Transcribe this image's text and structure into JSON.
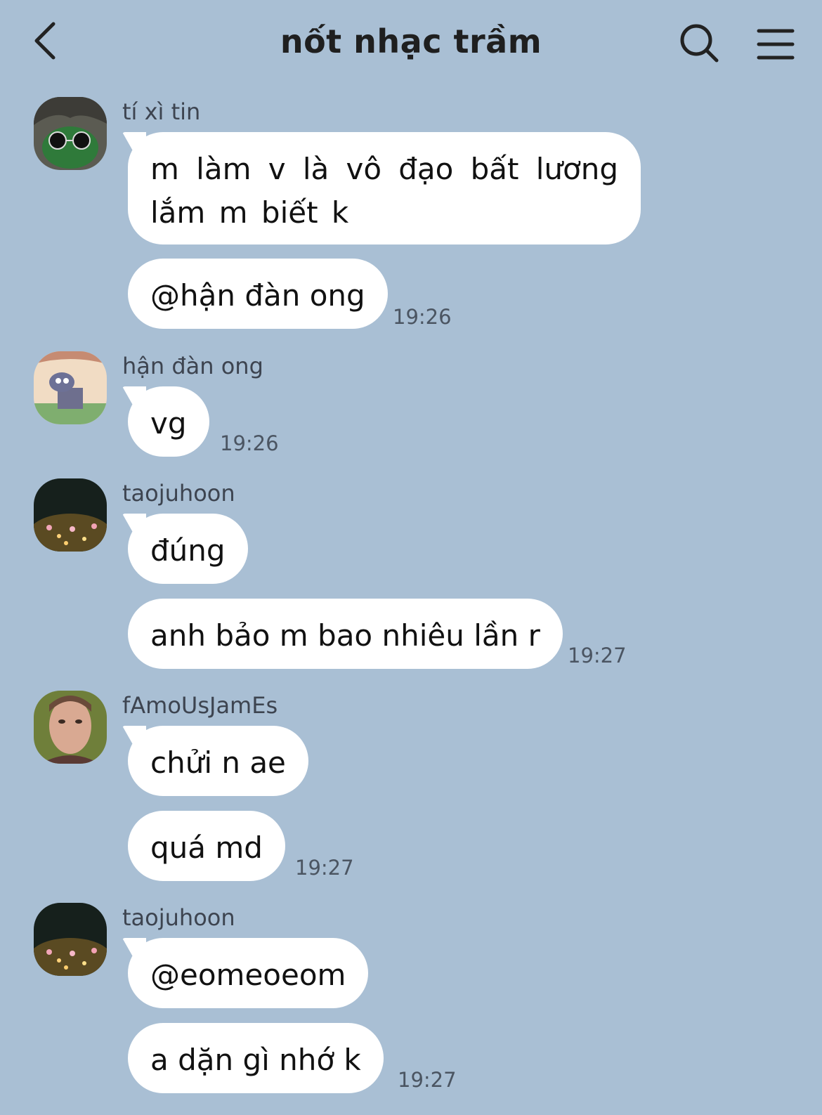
{
  "header": {
    "title": "nốt nhạc trầm",
    "back_icon": "chevron-left-icon",
    "search_icon": "search-icon",
    "menu_icon": "hamburger-menu-icon"
  },
  "colors": {
    "background": "#a9bfd4",
    "bubble": "#ffffff",
    "title": "#1f1f1f",
    "meta_text": "#4b5562"
  },
  "messages": [
    {
      "sender": "tí xì tin",
      "bubbles": [
        "m làm v là vô đạo bất lương lắm m biết k",
        "@hận đàn ong"
      ],
      "time": "19:26"
    },
    {
      "sender": "hận đàn ong",
      "bubbles": [
        "vg"
      ],
      "time": "19:26"
    },
    {
      "sender": "taojuhoon",
      "bubbles": [
        "đúng",
        "anh bảo m bao nhiêu lần r"
      ],
      "time": "19:27"
    },
    {
      "sender": "fAmoUsJamEs",
      "bubbles": [
        "chửi n ae",
        "quá md"
      ],
      "time": "19:27"
    },
    {
      "sender": "taojuhoon",
      "bubbles": [
        "@eomeoeom",
        "a dặn gì nhớ k"
      ],
      "time": "19:27"
    }
  ]
}
